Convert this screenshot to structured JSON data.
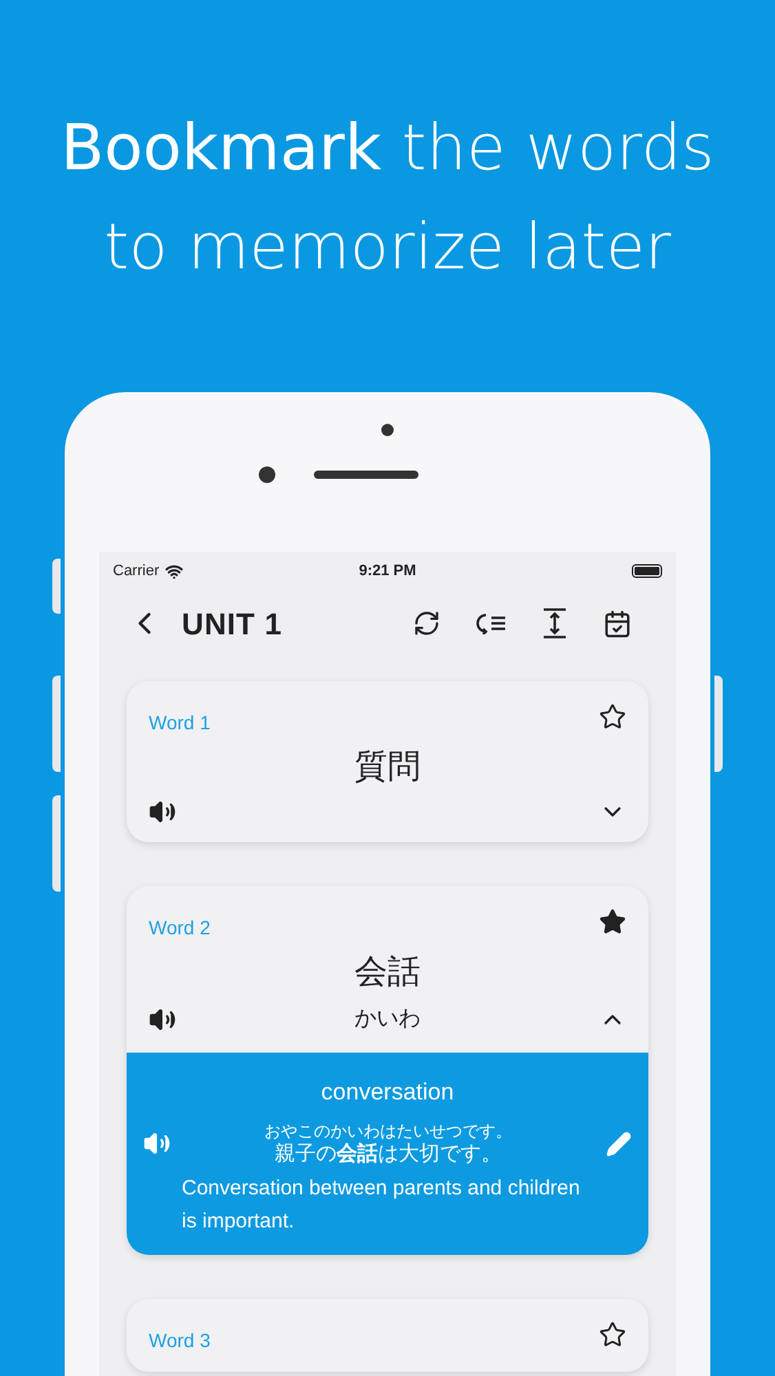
{
  "headline": [
    "**Bookmark** the words",
    "to memorize later"
  ],
  "status_bar": {
    "carrier": "Carrier",
    "time": "9:21 PM"
  },
  "nav": {
    "title": "UNIT 1"
  },
  "cards": [
    {
      "label": "Word 1",
      "word": "質問",
      "bookmarked": false,
      "expanded": false
    },
    {
      "label": "Word 2",
      "word": "会話",
      "reading": "かいわ",
      "bookmarked": true,
      "expanded": true,
      "meaning": "conversation",
      "example_reading": "おやこのかいわはたいせつです。",
      "example": "親子の**会話**は大切です。",
      "translation": "Conversation between parents and children is important."
    },
    {
      "label": "Word 3",
      "bookmarked": false
    }
  ]
}
